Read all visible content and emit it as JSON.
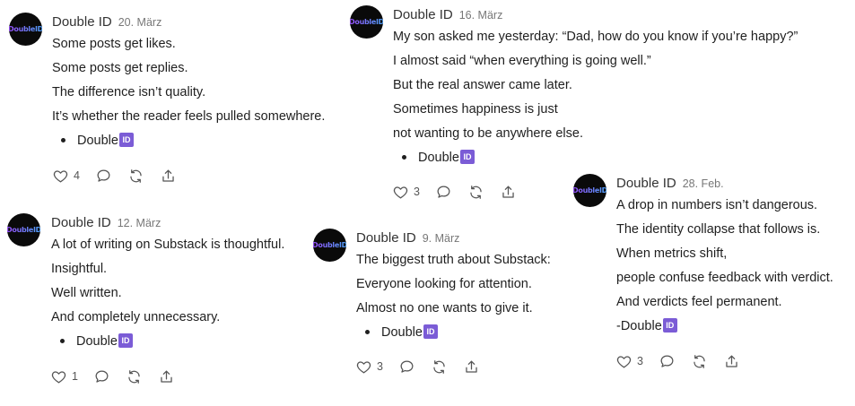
{
  "posts": [
    {
      "author": "Double ID",
      "date": "20. März",
      "avatar_text": "DoubleID",
      "lines": [
        "Some posts get likes.",
        "Some posts get replies.",
        "The difference isn’t quality.",
        "It’s whether the reader feels pulled somewhere."
      ],
      "signature": "Double",
      "badge": "ID",
      "likes": "4"
    },
    {
      "author": "Double ID",
      "date": "16. März",
      "avatar_text": "DoubleID",
      "lines": [
        "My son asked me yesterday: “Dad, how do you know if you’re happy?”",
        "I almost said “when everything is going well.”",
        "But the real answer came later.",
        "Sometimes happiness is just",
        "not wanting to be anywhere else."
      ],
      "signature": "Double",
      "badge": "ID",
      "likes": "3"
    },
    {
      "author": "Double ID",
      "date": "12. März",
      "avatar_text": "DoubleID",
      "lines": [
        "A lot of writing on Substack is thoughtful.",
        "Insightful.",
        "Well written.",
        "And completely unnecessary."
      ],
      "signature": "Double",
      "badge": "ID",
      "likes": "1"
    },
    {
      "author": "Double ID",
      "date": "9. März",
      "avatar_text": "DoubleID",
      "lines": [
        "The biggest truth about Substack:",
        "Everyone looking for attention.",
        "Almost no one wants to give it."
      ],
      "signature": "Double",
      "badge": "ID",
      "likes": "3"
    },
    {
      "author": "Double ID",
      "date": "28. Feb.",
      "avatar_text": "DoubleID",
      "lines": [
        "A drop in numbers isn’t dangerous.",
        "The identity collapse that follows is.",
        "When metrics shift,",
        "people confuse feedback with verdict.",
        "And verdicts feel permanent."
      ],
      "signature": "-Double",
      "badge": "ID",
      "likes": "3"
    }
  ],
  "icons": [
    "heart-icon",
    "comment-icon",
    "restack-icon",
    "share-icon"
  ],
  "colors": {
    "badge": "#7b5cd6",
    "avatar_bg": "#0a0a0a",
    "text": "#1f1f1f",
    "muted": "#777777"
  }
}
